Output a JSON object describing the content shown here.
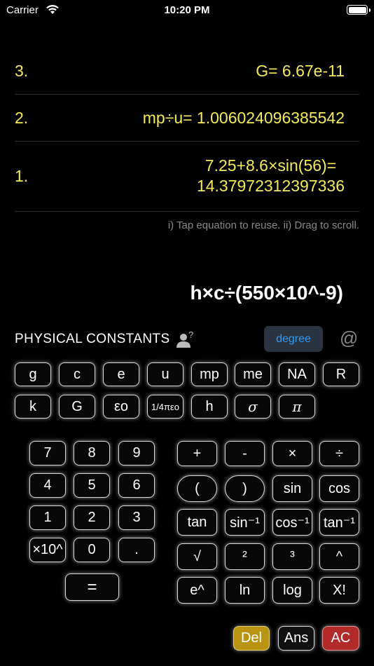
{
  "status": {
    "carrier": "Carrier",
    "time": "10:20 PM"
  },
  "history": [
    {
      "index": "3.",
      "equation": "G= 6.67e-11"
    },
    {
      "index": "2.",
      "equation": "mp÷u= 1.006024096385542"
    },
    {
      "index": "1.",
      "equation_line1": "7.25+8.6×sin(56)=",
      "equation_line2": "14.37972312397336"
    }
  ],
  "hint": "i) Tap equation to reuse. ii) Drag to scroll.",
  "expression": "h×c÷(550×10^-9)",
  "constants_header": {
    "label": "PHYSICAL CONSTANTS",
    "help_mark": "?",
    "angle_mode": "degree",
    "at": "@"
  },
  "constants_row1": [
    "g",
    "c",
    "e",
    "u",
    "mp",
    "me",
    "NA",
    "R"
  ],
  "constants_row2": [
    "k",
    "G",
    "εo",
    "1/4πεo",
    "h",
    "σ",
    "π"
  ],
  "keypad": {
    "r1": [
      "7",
      "8",
      "9"
    ],
    "r2": [
      "4",
      "5",
      "6"
    ],
    "r3": [
      "1",
      "2",
      "3"
    ],
    "r4": [
      "×10^",
      "0",
      "."
    ],
    "equals": "="
  },
  "functions": {
    "r1": [
      "+",
      "-",
      "×",
      "÷"
    ],
    "r2": [
      "(",
      ")",
      "sin",
      "cos"
    ],
    "r3": [
      "tan",
      "sin⁻¹",
      "cos⁻¹",
      "tan⁻¹"
    ],
    "r4": [
      "√",
      "²",
      "³",
      "^"
    ],
    "r5": [
      "e^",
      "ln",
      "log",
      "X!"
    ]
  },
  "actions": {
    "del": "Del",
    "ans": "Ans",
    "ac": "AC"
  },
  "colors": {
    "history_text": "#f4ea5a",
    "degree_text": "#2f9bf7",
    "del_bg": "#b89412",
    "ac_bg": "#b32a2a"
  }
}
